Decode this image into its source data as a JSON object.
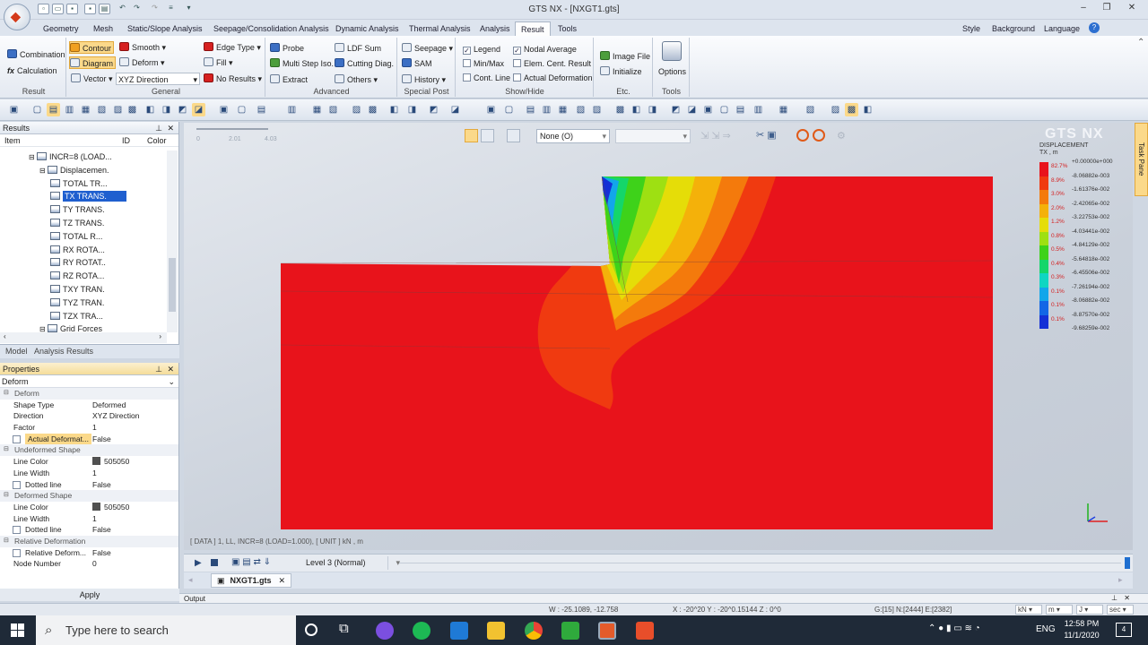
{
  "window": {
    "title": "GTS NX - [NXGT1.gts]"
  },
  "menu_tabs": [
    "Geometry",
    "Mesh",
    "Static/Slope Analysis",
    "Seepage/Consolidation Analysis",
    "Dynamic Analysis",
    "Thermal Analysis",
    "Analysis",
    "Result",
    "Tools"
  ],
  "menu_right": [
    "Style",
    "Background",
    "Language"
  ],
  "ribbon": {
    "result": {
      "items": [
        "Combination",
        "Calculation"
      ],
      "label": "Result"
    },
    "general": {
      "col1": [
        "Contour",
        "Diagram",
        "Vector"
      ],
      "col2": [
        "Smooth",
        "Deform",
        "XYZ Direction"
      ],
      "col3": [
        "Edge Type",
        "Fill",
        "No Results"
      ],
      "label": "General"
    },
    "advanced": {
      "col1": [
        "Probe",
        "Multi Step Iso.",
        "Extract"
      ],
      "col2": [
        "LDF Sum",
        "Cutting Diag.",
        "Others"
      ],
      "label": "Advanced"
    },
    "special_post": {
      "items": [
        "Seepage",
        "SAM",
        "History"
      ],
      "label": "Special Post"
    },
    "show_hide": {
      "col1": [
        "Legend",
        "Min/Max",
        "Cont. Line"
      ],
      "col2": [
        "Nodal Average",
        "Elem. Cent. Result",
        "Actual Deformation"
      ],
      "label": "Show/Hide"
    },
    "etc": {
      "items": [
        "Image File",
        "Initialize"
      ],
      "label": "Etc."
    },
    "tools": {
      "items": [
        "Options"
      ],
      "label": "Tools"
    }
  },
  "results_panel": {
    "title": "Results",
    "columns": [
      "Item",
      "ID",
      "Color"
    ],
    "tree": [
      {
        "label": "INCR=8 (LOAD...",
        "indent": 1
      },
      {
        "label": "Displacemen.",
        "indent": 2
      },
      {
        "label": "TOTAL TR...",
        "indent": 3
      },
      {
        "label": "TX TRANS.",
        "indent": 3,
        "selected": true
      },
      {
        "label": "TY TRANS.",
        "indent": 3
      },
      {
        "label": "TZ TRANS.",
        "indent": 3
      },
      {
        "label": "TOTAL R...",
        "indent": 3
      },
      {
        "label": "RX ROTA...",
        "indent": 3
      },
      {
        "label": "RY ROTAT..",
        "indent": 3
      },
      {
        "label": "RZ ROTA...",
        "indent": 3
      },
      {
        "label": "TXY TRAN.",
        "indent": 3
      },
      {
        "label": "TYZ TRAN.",
        "indent": 3
      },
      {
        "label": "TZX TRA...",
        "indent": 3
      },
      {
        "label": "Grid Forces",
        "indent": 2
      }
    ]
  },
  "panel_tabs": [
    "Model",
    "Analysis",
    "Results"
  ],
  "properties": {
    "title": "Properties",
    "dropdown": "Deform",
    "rows": [
      {
        "type": "section",
        "k": "Deform"
      },
      {
        "k": "Shape Type",
        "v": "Deformed"
      },
      {
        "k": "Direction",
        "v": "XYZ Direction"
      },
      {
        "k": "Factor",
        "v": "1"
      },
      {
        "k": "Actual Deformat...",
        "v": "False",
        "check": true,
        "hl": true
      },
      {
        "type": "section",
        "k": "Undeformed Shape"
      },
      {
        "k": "Line Color",
        "v": "505050",
        "swatch": true
      },
      {
        "k": "Line Width",
        "v": "1"
      },
      {
        "k": "Dotted line",
        "v": "False",
        "check": true
      },
      {
        "type": "section",
        "k": "Deformed Shape"
      },
      {
        "k": "Line Color",
        "v": "505050",
        "swatch": true
      },
      {
        "k": "Line Width",
        "v": "1"
      },
      {
        "k": "Dotted line",
        "v": "False",
        "check": true
      },
      {
        "type": "section",
        "k": "Relative Deformation"
      },
      {
        "k": "Relative Deform...",
        "v": "False",
        "check": true
      },
      {
        "k": "Node Number",
        "v": "0"
      }
    ],
    "apply": "Apply"
  },
  "viewport": {
    "ruler": [
      "0",
      "2.01",
      "4.03"
    ],
    "combo1": "None (O)",
    "combo2": "",
    "status": "[ DATA ]  1, LL, INCR=8 (LOAD=1.000), [ UNIT ]  kN , m",
    "watermark": "GTS NX",
    "legend": {
      "title": "DISPLACEMENT",
      "subtitle": "TX , m",
      "values": [
        "+0.00000e+000",
        "-8.06882e-003",
        "-1.61376e-002",
        "-2.42065e-002",
        "-3.22753e-002",
        "-4.03441e-002",
        "-4.84129e-002",
        "-5.64818e-002",
        "-6.45506e-002",
        "-7.26194e-002",
        "-8.06882e-002",
        "-8.87570e-002",
        "-9.68259e-002"
      ],
      "percents": [
        "82.7%",
        "8.9%",
        "3.0%",
        "2.0%",
        "1.2%",
        "0.8%",
        "0.5%",
        "0.4%",
        "0.3%",
        "0.1%",
        "0.1%",
        "0.1%"
      ],
      "colors": [
        "#e8131b",
        "#f03a10",
        "#f47a0c",
        "#f4b10a",
        "#e5dd08",
        "#9ee012",
        "#3ed21a",
        "#14d66a",
        "#0fd6c2",
        "#12a6ea",
        "#1266e6",
        "#1430d6"
      ]
    }
  },
  "animation": {
    "level": "Level 3 (Normal)"
  },
  "doc_tab": "NXGT1.gts",
  "output_label": "Output",
  "task_pane": "Task Pane",
  "statusbar": {
    "w": "W : -25.1089, -12.758",
    "x": "X : -20^20  Y : -20^0.15144  Z : 0^0",
    "g": "G:[15]  N:[2444]  E:[2382]",
    "units": [
      "kN",
      "m",
      "J",
      "sec"
    ]
  },
  "taskbar": {
    "search": "Type here to search",
    "lang": "ENG",
    "time": "12:58 PM",
    "date": "11/1/2020",
    "notif": "4"
  }
}
